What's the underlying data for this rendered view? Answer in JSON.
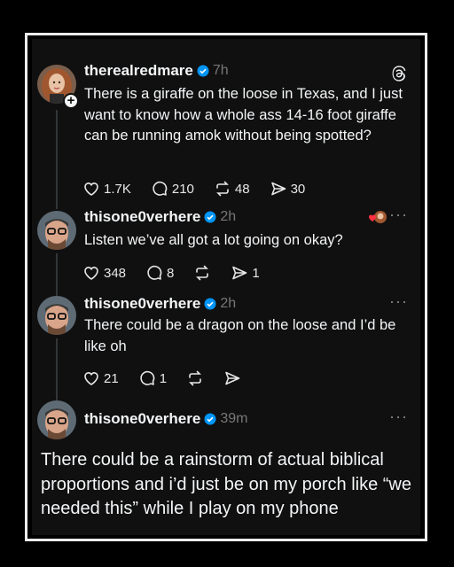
{
  "post1": {
    "username": "therealredmare",
    "time": "7h",
    "text": "There is a giraffe on the loose in Texas, and I just want to know how a whole ass 14-16 foot giraffe can be running amok without being spotted?",
    "likes": "1.7K",
    "replies": "210",
    "reposts": "48",
    "shares": "30"
  },
  "post2": {
    "username": "thisone0verhere",
    "time": "2h",
    "text": "Listen we’ve all got a lot going on okay?",
    "likes": "348",
    "replies": "8",
    "reposts": "",
    "shares": "1",
    "more": "···"
  },
  "post3": {
    "username": "thisone0verhere",
    "time": "2h",
    "text": "There could be a dragon on the loose and I’d be like oh",
    "likes": "21",
    "replies": "1",
    "more": "···"
  },
  "post4": {
    "username": "thisone0verhere",
    "time": "39m",
    "text": "There could be a rainstorm of actual biblical proportions and i’d just be on my porch like “we needed this” while I play on my phone",
    "more": "···"
  },
  "colors": {
    "background": "#101010",
    "verified": "#0095f6",
    "muted": "#777777",
    "like_heart": "#ff3040"
  },
  "icons": [
    "threads-logo-icon",
    "verified-icon",
    "heart-icon",
    "reply-icon",
    "repost-icon",
    "share-icon",
    "more-icon",
    "plus-icon"
  ]
}
